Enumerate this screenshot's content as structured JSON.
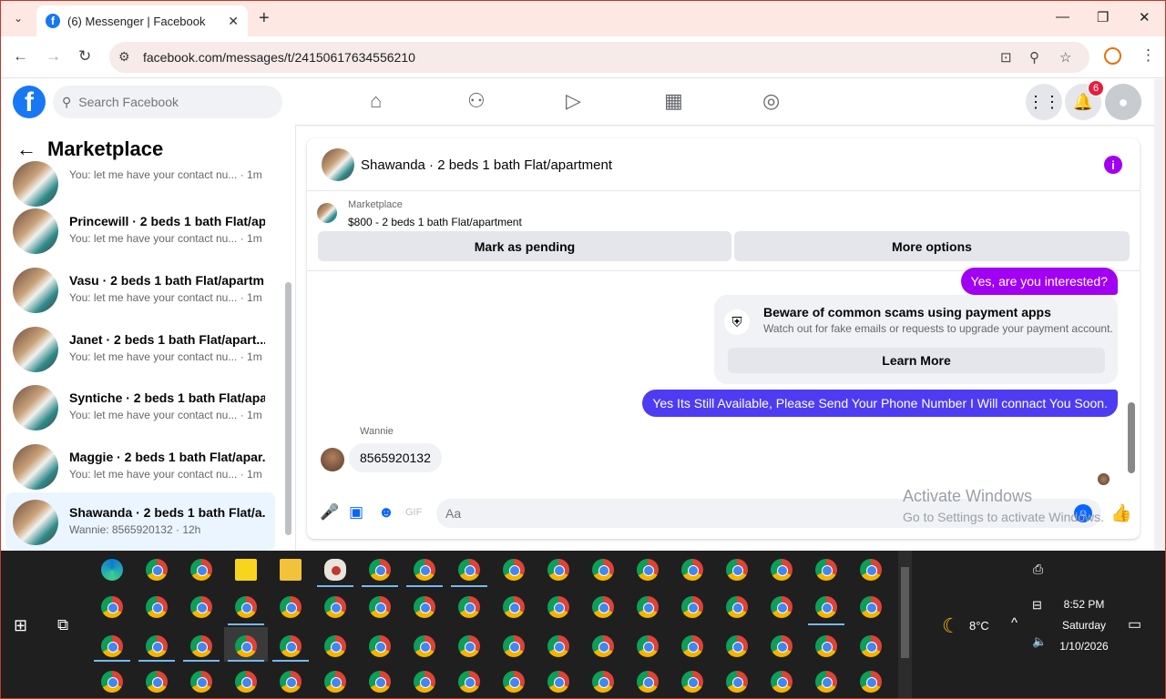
{
  "browser": {
    "tab_title": "(6) Messenger | Facebook",
    "url": "facebook.com/messages/t/24150617634556210"
  },
  "fb_header": {
    "search_placeholder": "Search Facebook",
    "notification_count": "6"
  },
  "left_panel": {
    "title": "Marketplace",
    "conversations": [
      {
        "name": "",
        "preview": "You: let me have your contact nu...",
        "time": "· 1m"
      },
      {
        "name": "Princewill · 2 beds 1 bath Flat/ap...",
        "preview": "You: let me have your contact nu...",
        "time": "· 1m"
      },
      {
        "name": "Vasu · 2 beds 1 bath Flat/apartm...",
        "preview": "You: let me have your contact nu...",
        "time": "· 1m"
      },
      {
        "name": "Janet · 2 beds 1 bath Flat/apart...",
        "preview": "You: let me have your contact nu...",
        "time": "· 1m"
      },
      {
        "name": "Syntiche · 2 beds 1 bath Flat/apa...",
        "preview": "You: let me have your contact nu...",
        "time": "· 1m"
      },
      {
        "name": "Maggie · 2 beds 1 bath Flat/apar...",
        "preview": "You: let me have your contact nu...",
        "time": "· 1m"
      },
      {
        "name": "Shawanda · 2 beds 1 bath Flat/a...",
        "preview": "Wannie: 8565920132",
        "time": "· 12h"
      }
    ]
  },
  "chat": {
    "title": "Shawanda · 2 beds 1 bath Flat/apartment",
    "marketplace_label": "Marketplace",
    "listing": "$800 - 2 beds 1 bath Flat/apartment",
    "mark_pending": "Mark as pending",
    "more_options": "More options",
    "messages": {
      "out1": "Yes, are you interested?",
      "scam_title": "Beware of common scams using payment apps",
      "scam_body": "Watch out for fake emails or requests to upgrade your payment account.",
      "learn_more": "Learn More",
      "out2": "Yes Its Still Available, Please Send Your Phone Number I Will connact You Soon.",
      "sender": "Wannie",
      "in1": "8565920132"
    },
    "composer_placeholder": "Aa"
  },
  "colors": {
    "out_bubble_1": "#a100f2",
    "out_bubble_2": "#4e3cf2",
    "fb_blue": "#1877f2"
  },
  "watermark": {
    "line1": "Activate Windows",
    "line2": "Go to Settings to activate Windows."
  },
  "taskbar": {
    "weather": "8°C",
    "time": "8:52 PM",
    "day": "Saturday",
    "date": "1/10/2026"
  }
}
